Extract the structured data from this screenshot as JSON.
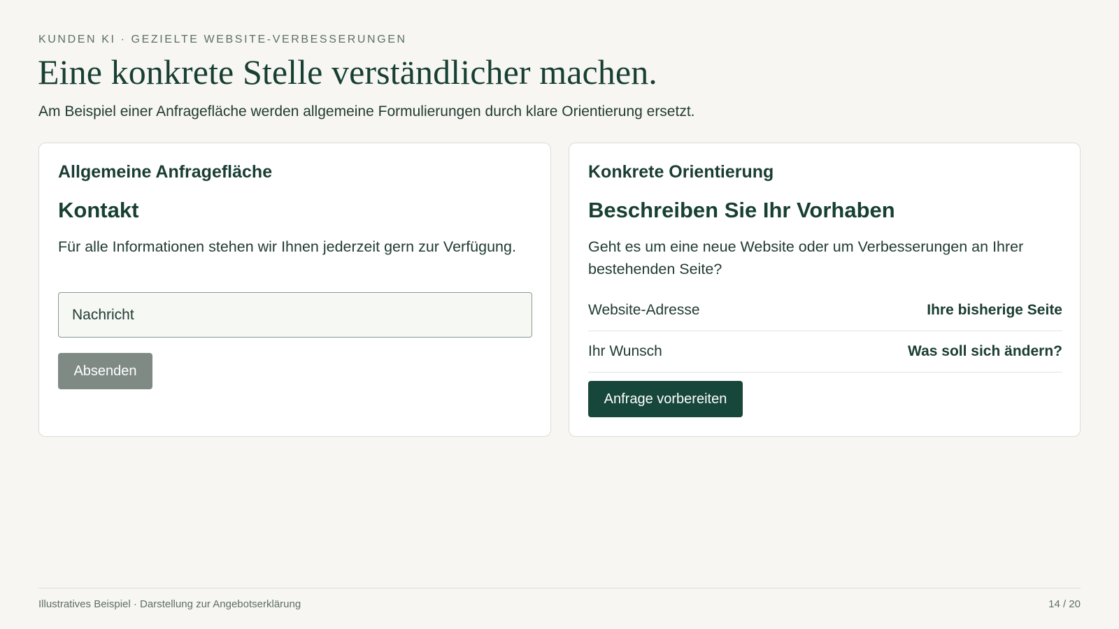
{
  "header": {
    "eyebrow": "KUNDEN KI · GEZIELTE WEBSITE-VERBESSERUNGEN",
    "title": "Eine konkrete Stelle verständlicher machen.",
    "subtitle": "Am Beispiel einer Anfragefläche werden allgemeine Formulierungen durch klare Orientierung ersetzt."
  },
  "left_card": {
    "heading": "Allgemeine Anfragefläche",
    "title": "Kontakt",
    "text": "Für alle Informationen stehen wir Ihnen jederzeit gern zur Verfügung.",
    "input_placeholder": "Nachricht",
    "button_label": "Absenden"
  },
  "right_card": {
    "heading": "Konkrete Orientierung",
    "title": "Beschreiben Sie Ihr Vorhaben",
    "text": "Geht es um eine neue Website oder um Verbesserungen an Ihrer bestehenden Seite?",
    "fields": [
      {
        "label": "Website-Adresse",
        "value": "Ihre bisherige Seite"
      },
      {
        "label": "Ihr Wunsch",
        "value": "Was soll sich ändern?"
      }
    ],
    "button_label": "Anfrage vorbereiten"
  },
  "footer": {
    "note": "Illustratives Beispiel · Darstellung zur Angebotserklärung",
    "page_indicator": "14 / 20"
  },
  "colors": {
    "background": "#f7f6f2",
    "primary": "#17473a",
    "muted_button": "#7f8a85",
    "text": "#1b3d33"
  }
}
